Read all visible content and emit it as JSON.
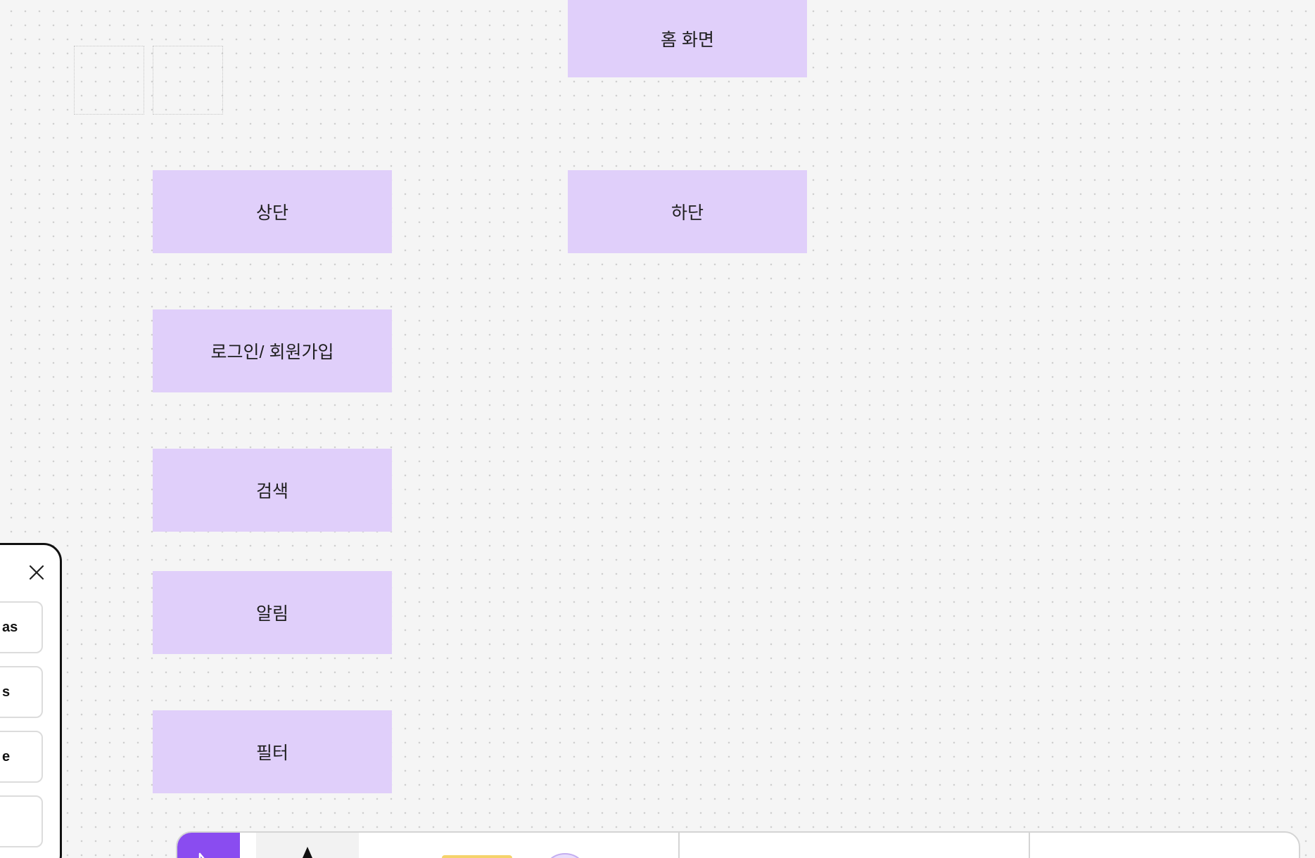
{
  "board": {
    "placeholder_frames": [
      "",
      ""
    ],
    "stickies": {
      "home": "홈 화면",
      "header": "상단",
      "footer": "하단",
      "login_signup": "로그인/ 회원가입",
      "search": "검색",
      "notifications": "알림",
      "filter": "필터"
    }
  },
  "side_panel": {
    "close_icon": "close-icon",
    "options": [
      "as",
      "s",
      "e",
      ""
    ]
  },
  "toolbar": {
    "tools": [
      "select-tool",
      "pen-tool",
      "sticky-note-tool",
      "shapes-tool",
      "stamp-tool"
    ],
    "accent_color": "#8a4cf0",
    "sticky_color": "#f5d36b"
  },
  "colors": {
    "canvas_bg": "#f5f5f5",
    "sticky_purple": "#e0cffa"
  }
}
